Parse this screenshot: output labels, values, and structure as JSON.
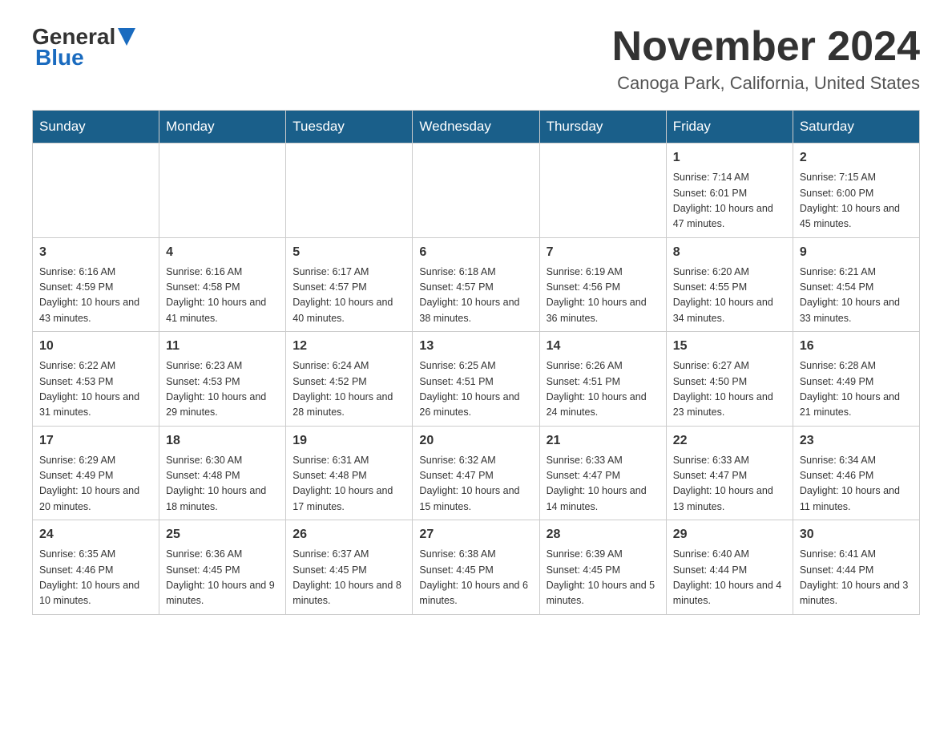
{
  "header": {
    "logo_general": "General",
    "logo_blue": "Blue",
    "month_title": "November 2024",
    "location": "Canoga Park, California, United States"
  },
  "calendar": {
    "days_of_week": [
      "Sunday",
      "Monday",
      "Tuesday",
      "Wednesday",
      "Thursday",
      "Friday",
      "Saturday"
    ],
    "weeks": [
      [
        {
          "day": "",
          "info": ""
        },
        {
          "day": "",
          "info": ""
        },
        {
          "day": "",
          "info": ""
        },
        {
          "day": "",
          "info": ""
        },
        {
          "day": "",
          "info": ""
        },
        {
          "day": "1",
          "info": "Sunrise: 7:14 AM\nSunset: 6:01 PM\nDaylight: 10 hours and 47 minutes."
        },
        {
          "day": "2",
          "info": "Sunrise: 7:15 AM\nSunset: 6:00 PM\nDaylight: 10 hours and 45 minutes."
        }
      ],
      [
        {
          "day": "3",
          "info": "Sunrise: 6:16 AM\nSunset: 4:59 PM\nDaylight: 10 hours and 43 minutes."
        },
        {
          "day": "4",
          "info": "Sunrise: 6:16 AM\nSunset: 4:58 PM\nDaylight: 10 hours and 41 minutes."
        },
        {
          "day": "5",
          "info": "Sunrise: 6:17 AM\nSunset: 4:57 PM\nDaylight: 10 hours and 40 minutes."
        },
        {
          "day": "6",
          "info": "Sunrise: 6:18 AM\nSunset: 4:57 PM\nDaylight: 10 hours and 38 minutes."
        },
        {
          "day": "7",
          "info": "Sunrise: 6:19 AM\nSunset: 4:56 PM\nDaylight: 10 hours and 36 minutes."
        },
        {
          "day": "8",
          "info": "Sunrise: 6:20 AM\nSunset: 4:55 PM\nDaylight: 10 hours and 34 minutes."
        },
        {
          "day": "9",
          "info": "Sunrise: 6:21 AM\nSunset: 4:54 PM\nDaylight: 10 hours and 33 minutes."
        }
      ],
      [
        {
          "day": "10",
          "info": "Sunrise: 6:22 AM\nSunset: 4:53 PM\nDaylight: 10 hours and 31 minutes."
        },
        {
          "day": "11",
          "info": "Sunrise: 6:23 AM\nSunset: 4:53 PM\nDaylight: 10 hours and 29 minutes."
        },
        {
          "day": "12",
          "info": "Sunrise: 6:24 AM\nSunset: 4:52 PM\nDaylight: 10 hours and 28 minutes."
        },
        {
          "day": "13",
          "info": "Sunrise: 6:25 AM\nSunset: 4:51 PM\nDaylight: 10 hours and 26 minutes."
        },
        {
          "day": "14",
          "info": "Sunrise: 6:26 AM\nSunset: 4:51 PM\nDaylight: 10 hours and 24 minutes."
        },
        {
          "day": "15",
          "info": "Sunrise: 6:27 AM\nSunset: 4:50 PM\nDaylight: 10 hours and 23 minutes."
        },
        {
          "day": "16",
          "info": "Sunrise: 6:28 AM\nSunset: 4:49 PM\nDaylight: 10 hours and 21 minutes."
        }
      ],
      [
        {
          "day": "17",
          "info": "Sunrise: 6:29 AM\nSunset: 4:49 PM\nDaylight: 10 hours and 20 minutes."
        },
        {
          "day": "18",
          "info": "Sunrise: 6:30 AM\nSunset: 4:48 PM\nDaylight: 10 hours and 18 minutes."
        },
        {
          "day": "19",
          "info": "Sunrise: 6:31 AM\nSunset: 4:48 PM\nDaylight: 10 hours and 17 minutes."
        },
        {
          "day": "20",
          "info": "Sunrise: 6:32 AM\nSunset: 4:47 PM\nDaylight: 10 hours and 15 minutes."
        },
        {
          "day": "21",
          "info": "Sunrise: 6:33 AM\nSunset: 4:47 PM\nDaylight: 10 hours and 14 minutes."
        },
        {
          "day": "22",
          "info": "Sunrise: 6:33 AM\nSunset: 4:47 PM\nDaylight: 10 hours and 13 minutes."
        },
        {
          "day": "23",
          "info": "Sunrise: 6:34 AM\nSunset: 4:46 PM\nDaylight: 10 hours and 11 minutes."
        }
      ],
      [
        {
          "day": "24",
          "info": "Sunrise: 6:35 AM\nSunset: 4:46 PM\nDaylight: 10 hours and 10 minutes."
        },
        {
          "day": "25",
          "info": "Sunrise: 6:36 AM\nSunset: 4:45 PM\nDaylight: 10 hours and 9 minutes."
        },
        {
          "day": "26",
          "info": "Sunrise: 6:37 AM\nSunset: 4:45 PM\nDaylight: 10 hours and 8 minutes."
        },
        {
          "day": "27",
          "info": "Sunrise: 6:38 AM\nSunset: 4:45 PM\nDaylight: 10 hours and 6 minutes."
        },
        {
          "day": "28",
          "info": "Sunrise: 6:39 AM\nSunset: 4:45 PM\nDaylight: 10 hours and 5 minutes."
        },
        {
          "day": "29",
          "info": "Sunrise: 6:40 AM\nSunset: 4:44 PM\nDaylight: 10 hours and 4 minutes."
        },
        {
          "day": "30",
          "info": "Sunrise: 6:41 AM\nSunset: 4:44 PM\nDaylight: 10 hours and 3 minutes."
        }
      ]
    ]
  }
}
